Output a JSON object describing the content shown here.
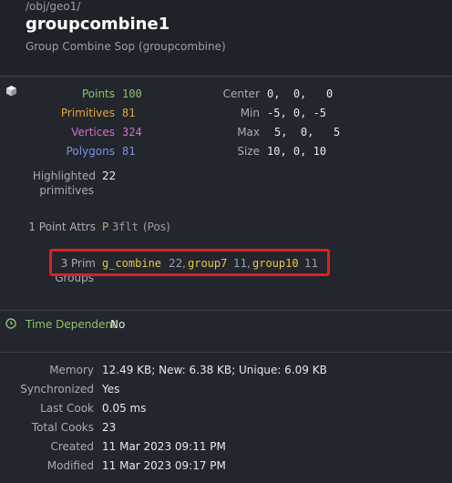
{
  "header": {
    "path": "/obj/geo1/",
    "node_name": "groupcombine1",
    "node_type": "Group Combine Sop (groupcombine)"
  },
  "stats": {
    "points_label": "Points",
    "points_value": "100",
    "prims_label": "Primitives",
    "prims_value": "81",
    "verts_label": "Vertices",
    "verts_value": "324",
    "polys_label": "Polygons",
    "polys_value": "81"
  },
  "bounds": {
    "center_label": "Center",
    "center_value": "0,  0,   0",
    "min_label": "Min",
    "min_value": "-5, 0, -5",
    "max_label": "Max",
    "max_value": "5,  0,   5",
    "size_label": "Size",
    "size_value": "10, 0, 10"
  },
  "highlighted": {
    "label_line1": "Highlighted",
    "label_line2": "primitives",
    "value": "22"
  },
  "point_attrs": {
    "label": "1 Point Attrs",
    "class": "P",
    "size": "3flt",
    "name": "(Pos)"
  },
  "prim_groups": {
    "label_line1": "3 Prim",
    "label_line2": "Groups",
    "groups": [
      {
        "name": "g_combine",
        "count": "22"
      },
      {
        "name": "group7",
        "count": "11"
      },
      {
        "name": "group10",
        "count": "11"
      }
    ],
    "separator": ","
  },
  "time_dependent": {
    "label": "Time Dependent",
    "value": "No"
  },
  "info": {
    "memory_label": "Memory",
    "memory_value": "12.49 KB; New: 6.38 KB; Unique: 6.09 KB",
    "sync_label": "Synchronized",
    "sync_value": "Yes",
    "lastcook_label": "Last Cook",
    "lastcook_value": "0.05 ms",
    "totalcooks_label": "Total Cooks",
    "totalcooks_value": "23",
    "created_label": "Created",
    "created_value": "11 Mar 2023 09:11 PM",
    "modified_label": "Modified",
    "modified_value": "11 Mar 2023 09:17 PM"
  },
  "colors": {
    "points": "#8dc26f",
    "primitives": "#e7a33d",
    "vertices": "#d070c8",
    "polygons": "#7c93e0",
    "highlight_border": "#e01f1f",
    "group_name": "#e7c84a"
  },
  "icons": {
    "geometry": "geometry-cube-icon",
    "time": "clock-icon"
  }
}
